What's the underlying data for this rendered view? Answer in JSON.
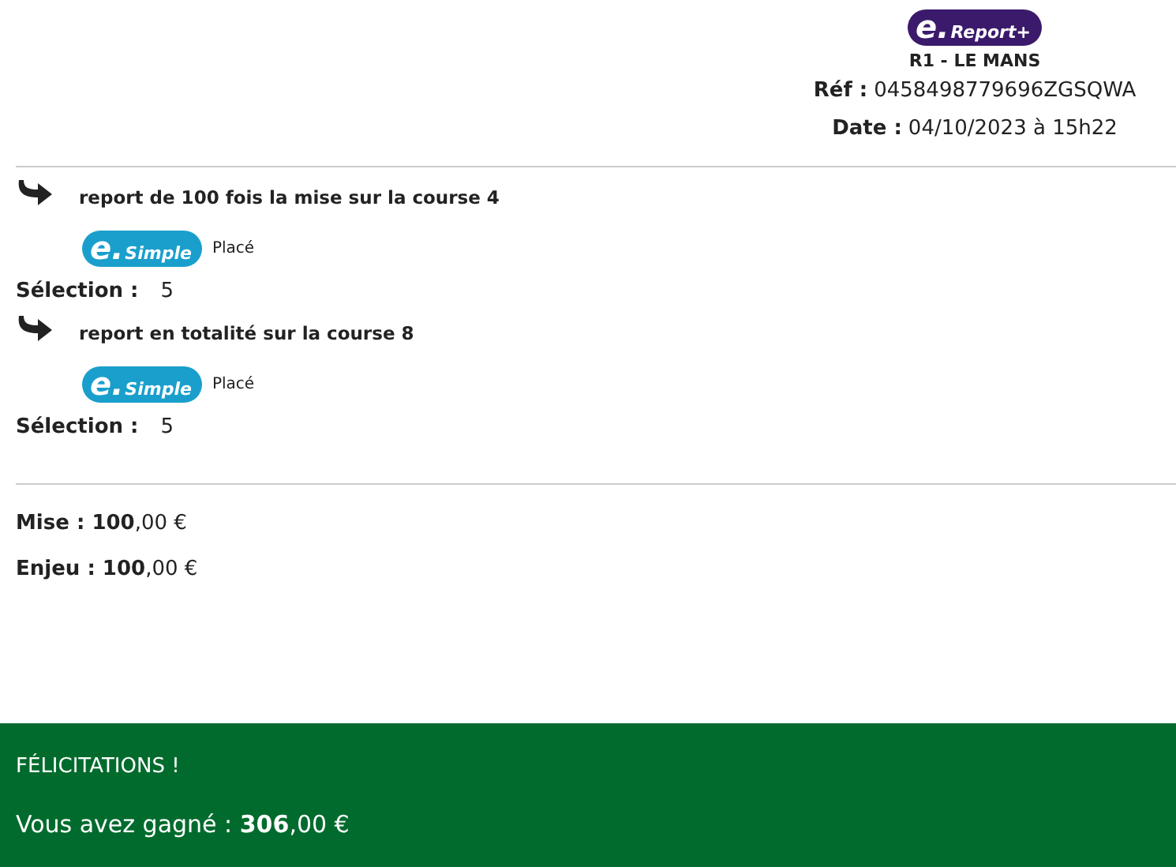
{
  "header": {
    "logo": {
      "prefix": "e.",
      "name": "Report+"
    },
    "race": "R1 - LE MANS",
    "ref": {
      "label": "Réf :",
      "value": "0458498779696ZGSQWA"
    },
    "date": {
      "label": "Date :",
      "value": "04/10/2023 à 15h22"
    }
  },
  "legs": [
    {
      "title": "report de 100 fois la mise sur la course 4",
      "bet": {
        "prefix": "e.",
        "name": "Simple"
      },
      "bet_type": "Placé",
      "selection_label": "Sélection :",
      "selection": "5"
    },
    {
      "title": "report en totalité sur la course 8",
      "bet": {
        "prefix": "e.",
        "name": "Simple"
      },
      "bet_type": "Placé",
      "selection_label": "Sélection :",
      "selection": "5"
    }
  ],
  "totals": [
    "**Mise : 100**,00 €",
    "**Enjeu : 100**,00 €"
  ],
  "result": {
    "title": "FÉLICITATIONS !",
    "message": "Vous avez gagné : **306**,00 €"
  }
}
